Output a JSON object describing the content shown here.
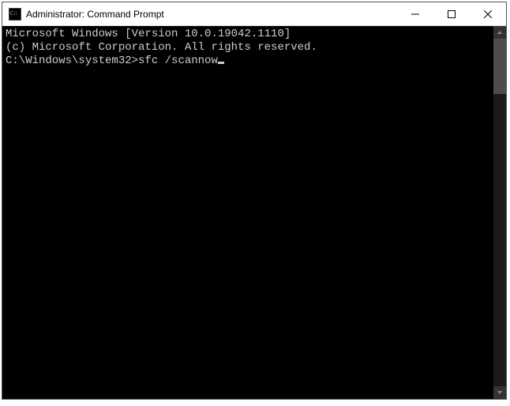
{
  "titlebar": {
    "title": "Administrator: Command Prompt",
    "icon": "cmd-icon"
  },
  "console": {
    "line1": "Microsoft Windows [Version 10.0.19042.1110]",
    "line2": "(c) Microsoft Corporation. All rights reserved.",
    "blank": "",
    "prompt": "C:\\Windows\\system32>",
    "command": "sfc /scannow"
  }
}
